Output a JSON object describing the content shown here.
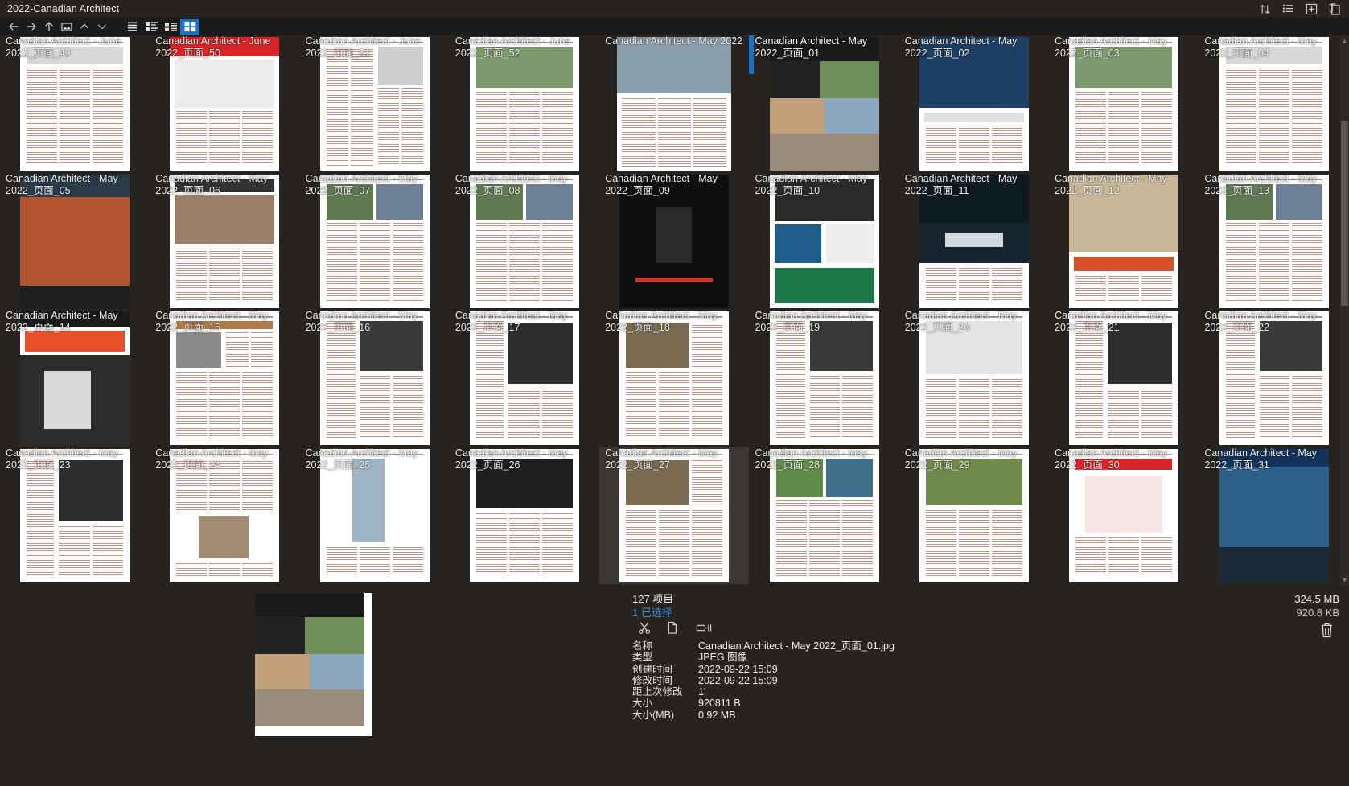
{
  "window": {
    "title": "2022-Canadian Architect"
  },
  "titlebar_icons": [
    {
      "name": "sort-icon",
      "glyph": "sort"
    },
    {
      "name": "list-view-icon",
      "glyph": "list"
    },
    {
      "name": "add-box-icon",
      "glyph": "plus-box"
    },
    {
      "name": "clipboard-icon",
      "glyph": "clipboard"
    }
  ],
  "toolbar": {
    "nav": [
      {
        "name": "back-button",
        "glyph": "arrow-left"
      },
      {
        "name": "forward-button",
        "glyph": "arrow-right"
      },
      {
        "name": "up-button",
        "glyph": "arrow-up"
      },
      {
        "name": "folder-image-button",
        "glyph": "folder-image"
      },
      {
        "name": "chevron-up-button",
        "glyph": "chevron-up"
      },
      {
        "name": "chevron-down-button",
        "glyph": "chevron-down"
      }
    ],
    "views": [
      {
        "name": "view-list-button",
        "glyph": "view-list",
        "active": false
      },
      {
        "name": "view-tiles-button",
        "glyph": "view-tiles",
        "active": false
      },
      {
        "name": "view-details-button",
        "glyph": "view-details",
        "active": false
      },
      {
        "name": "view-grid-button",
        "glyph": "view-grid",
        "active": true
      }
    ]
  },
  "colors": {
    "accent": "#1b72c4",
    "link": "#3a90da",
    "background": "#262320",
    "toolbar_bg": "#1b1b1b",
    "hover": "#3a3734"
  },
  "grid": {
    "items": [
      {
        "label": "Canadian Architect - June 2022_页面_49",
        "style": "news-grey",
        "selected": false,
        "hovered": false
      },
      {
        "label": "Canadian Architect - June 2022_页面_50",
        "style": "red-cover",
        "selected": false,
        "hovered": false
      },
      {
        "label": "Canadian Architect - June 2022_页面_51",
        "style": "text-two",
        "selected": false,
        "hovered": false
      },
      {
        "label": "Canadian Architect - June 2022_页面_52",
        "style": "photo-top",
        "selected": false,
        "hovered": false
      },
      {
        "label": "Canadian Architect - May 2022",
        "style": "photo-wide",
        "selected": false,
        "hovered": false
      },
      {
        "label": "Canadian Architect - May 2022_页面_01",
        "style": "cover-collage",
        "selected": true,
        "hovered": false
      },
      {
        "label": "Canadian Architect - May 2022_页面_02",
        "style": "ad-blue",
        "selected": false,
        "hovered": false
      },
      {
        "label": "Canadian Architect - May 2022_页面_03",
        "style": "photo-top",
        "selected": false,
        "hovered": false
      },
      {
        "label": "Canadian Architect - May 2022_页面_04",
        "style": "news-grey",
        "selected": false,
        "hovered": false
      },
      {
        "label": "Canadian Architect - May 2022_页面_05",
        "style": "dark-bldg",
        "selected": false,
        "hovered": false
      },
      {
        "label": "Canadian Architect - May 2022_页面_06",
        "style": "strategize",
        "selected": false,
        "hovered": false
      },
      {
        "label": "Canadian Architect - May 2022_页面_07",
        "style": "news-photo",
        "selected": false,
        "hovered": false
      },
      {
        "label": "Canadian Architect - May 2022_页面_08",
        "style": "news-photo",
        "selected": false,
        "hovered": false
      },
      {
        "label": "Canadian Architect - May 2022_页面_09",
        "style": "dark-ad",
        "selected": false,
        "hovered": false
      },
      {
        "label": "Canadian Architect - May 2022_页面_10",
        "style": "hiring-ad",
        "selected": false,
        "hovered": false
      },
      {
        "label": "Canadian Architect - May 2022_页面_11",
        "style": "alu-ad",
        "selected": false,
        "hovered": false
      },
      {
        "label": "Canadian Architect - May 2022_页面_12",
        "style": "timber-ad",
        "selected": false,
        "hovered": false
      },
      {
        "label": "Canadian Architect - May 2022_页面_13",
        "style": "news-photo",
        "selected": false,
        "hovered": false
      },
      {
        "label": "Canadian Architect - May 2022_页面_14",
        "style": "steel-cover",
        "selected": false,
        "hovered": false
      },
      {
        "label": "Canadian Architect - May 2022_页面_15",
        "style": "raic",
        "selected": false,
        "hovered": false
      },
      {
        "label": "Canadian Architect - May 2022_页面_16",
        "style": "bw-photo",
        "selected": false,
        "hovered": false
      },
      {
        "label": "Canadian Architect - May 2022_页面_17",
        "style": "bw-photo2",
        "selected": false,
        "hovered": false
      },
      {
        "label": "Canadian Architect - May 2022_页面_18",
        "style": "aerial",
        "selected": false,
        "hovered": false
      },
      {
        "label": "Canadian Architect - May 2022_页面_19",
        "style": "bw-photo",
        "selected": false,
        "hovered": false
      },
      {
        "label": "Canadian Architect - May 2022_页面_20",
        "style": "white-arch",
        "selected": false,
        "hovered": false
      },
      {
        "label": "Canadian Architect - May 2022_页面_21",
        "style": "bw-photo2",
        "selected": false,
        "hovered": false
      },
      {
        "label": "Canadian Architect - May 2022_页面_22",
        "style": "bw-photo",
        "selected": false,
        "hovered": false
      },
      {
        "label": "Canadian Architect - May 2022_页面_23",
        "style": "bw-photo2",
        "selected": false,
        "hovered": false
      },
      {
        "label": "Canadian Architect - May 2022_页面_24",
        "style": "portrait",
        "selected": false,
        "hovered": false
      },
      {
        "label": "Canadian Architect - May 2022_页面_25",
        "style": "tower",
        "selected": false,
        "hovered": false
      },
      {
        "label": "Canadian Architect - May 2022_页面_26",
        "style": "bw-interior",
        "selected": false,
        "hovered": false
      },
      {
        "label": "Canadian Architect - May 2022_页面_27",
        "style": "aerial",
        "selected": false,
        "hovered": true
      },
      {
        "label": "Canadian Architect - May 2022_页面_28",
        "style": "green-pool",
        "selected": false,
        "hovered": false
      },
      {
        "label": "Canadian Architect - May 2022_页面_29",
        "style": "roof-green",
        "selected": false,
        "hovered": false
      },
      {
        "label": "Canadian Architect - May 2022_页面_30",
        "style": "red-diagram",
        "selected": false,
        "hovered": false
      },
      {
        "label": "Canadian Architect - May 2022_页面_31",
        "style": "steel-blue",
        "selected": false,
        "hovered": false
      },
      {
        "label": "",
        "style": "aerial-lake",
        "selected": false,
        "hovered": false
      },
      {
        "label": "",
        "style": "malahat",
        "selected": false,
        "hovered": false
      },
      {
        "label": "",
        "style": "longboard",
        "selected": false,
        "hovered": false
      },
      {
        "label": "",
        "style": "kohler",
        "selected": false,
        "hovered": false
      },
      {
        "label": "",
        "style": "unity",
        "selected": false,
        "hovered": false
      },
      {
        "label": "",
        "style": "indigenous",
        "selected": false,
        "hovered": false
      },
      {
        "label": "",
        "style": "wood-panels",
        "selected": false,
        "hovered": false
      },
      {
        "label": "",
        "style": "kelly",
        "selected": false,
        "hovered": false
      },
      {
        "label": "",
        "style": "interior-row",
        "selected": false,
        "hovered": false
      }
    ]
  },
  "info": {
    "item_count": "127 项目",
    "selected_count": "1 已选择",
    "actions": [
      {
        "name": "cut-button",
        "glyph": "scissors"
      },
      {
        "name": "copy-button",
        "glyph": "copy"
      },
      {
        "name": "rename-button",
        "glyph": "rename"
      }
    ],
    "metadata": [
      {
        "key": "名称",
        "value": "Canadian Architect - May 2022_页面_01.jpg"
      },
      {
        "key": "类型",
        "value": "JPEG 图像"
      },
      {
        "key": "创建时间",
        "value": "2022-09-22  15:09"
      },
      {
        "key": "修改时间",
        "value": "2022-09-22  15:09"
      },
      {
        "key": "距上次修改",
        "value": "1'"
      },
      {
        "key": "大小",
        "value": "920811 B"
      },
      {
        "key": "大小(MB)",
        "value": "0.92 MB"
      }
    ],
    "total_size": "324.5 MB",
    "selected_size": "920.8 KB",
    "delete_icon": "trash-icon"
  }
}
